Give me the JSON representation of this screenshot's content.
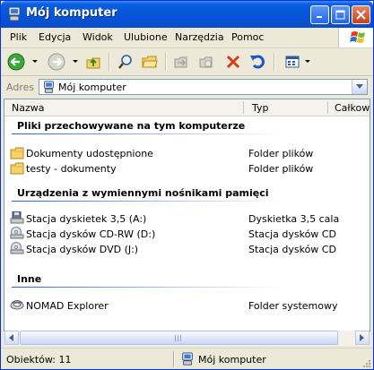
{
  "window": {
    "title": "Mój komputer",
    "colors": {
      "titlebar": "#0653d8",
      "group_header_line": "#2a5ec8"
    }
  },
  "menubar": {
    "items": [
      "Plik",
      "Edycja",
      "Widok",
      "Ulubione",
      "Narzędzia",
      "Pomoc"
    ]
  },
  "toolbar": {
    "icons": [
      "back-icon",
      "forward-icon",
      "up-folder-icon",
      "search-icon",
      "folders-icon",
      "move-to-icon",
      "copy-to-icon",
      "delete-icon",
      "undo-icon",
      "views-icon"
    ]
  },
  "address": {
    "label": "Adres",
    "value": "Mój komputer"
  },
  "columns": [
    "Nazwa",
    "Typ",
    "Całkow"
  ],
  "groups": [
    {
      "title": "Pliki przechowywane na tym komputerze",
      "items": [
        {
          "name": "Dokumenty udostępnione",
          "type": "Folder plików",
          "icon": "shared-folder-icon"
        },
        {
          "name": "testy - dokumenty",
          "type": "Folder plików",
          "icon": "folder-icon"
        }
      ]
    },
    {
      "title": "Urządzenia z wymiennymi nośnikami pamięci",
      "items": [
        {
          "name": "Stacja dyskietek 3,5 (A:)",
          "type": "Dyskietka 3,5 cala",
          "icon": "floppy-drive-icon"
        },
        {
          "name": "Stacja dysków CD-RW (D:)",
          "type": "Stacja dysków CD",
          "icon": "cd-drive-icon"
        },
        {
          "name": "Stacja dysków DVD (J:)",
          "type": "Stacja dysków CD",
          "icon": "dvd-drive-icon"
        }
      ]
    },
    {
      "title": "Inne",
      "items": [
        {
          "name": "NOMAD Explorer",
          "type": "Folder systemowy",
          "icon": "nomad-explorer-icon"
        }
      ]
    }
  ],
  "status": {
    "objects": "Obiektów: 11",
    "location": "Mój komputer"
  }
}
